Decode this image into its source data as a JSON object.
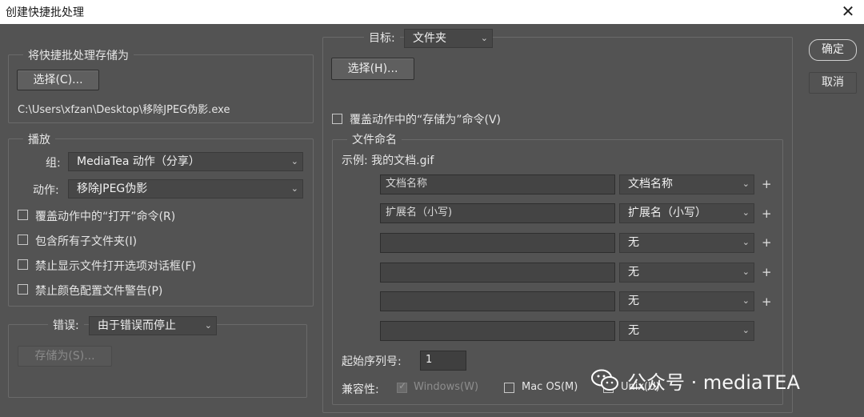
{
  "window": {
    "title": "创建快捷批处理",
    "close_glyph": "✕"
  },
  "save_section": {
    "legend": "将快捷批处理存储为",
    "choose_button": "选择(C)...",
    "path": "C:\\Users\\xfzan\\Desktop\\移除JPEG伪影.exe"
  },
  "play_section": {
    "legend": "播放",
    "group_label": "组:",
    "group_value": "MediaTea 动作（分享）",
    "action_label": "动作:",
    "action_value": "移除JPEG伪影",
    "checkboxes": [
      {
        "label": "覆盖动作中的“打开”命令(R)",
        "checked": false
      },
      {
        "label": "包含所有子文件夹(I)",
        "checked": false
      },
      {
        "label": "禁止显示文件打开选项对话框(F)",
        "checked": false
      },
      {
        "label": "禁止颜色配置文件警告(P)",
        "checked": false
      }
    ]
  },
  "error_section": {
    "label": "错误:",
    "value": "由于错误而停止",
    "save_as_button": "存储为(S)..."
  },
  "target_section": {
    "label": "目标:",
    "value": "文件夹",
    "choose_button": "选择(H)...",
    "override_save_as": {
      "label": "覆盖动作中的“存储为”命令(V)",
      "checked": false
    }
  },
  "naming": {
    "legend": "文件命名",
    "example": "示例: 我的文档.gif",
    "rows": [
      {
        "field": "文档名称",
        "select": "文档名称",
        "plus": "+"
      },
      {
        "field": "扩展名（小写)",
        "select": "扩展名（小写）",
        "plus": "+"
      },
      {
        "field": "",
        "select": "无",
        "plus": "+"
      },
      {
        "field": "",
        "select": "无",
        "plus": "+"
      },
      {
        "field": "",
        "select": "无",
        "plus": "+"
      },
      {
        "field": "",
        "select": "无",
        "plus": ""
      }
    ],
    "start_serial_label": "起始序列号:",
    "start_serial_value": "1",
    "compat_label": "兼容性:",
    "compat": [
      {
        "label": "Windows(W)",
        "checked": true,
        "disabled": true
      },
      {
        "label": "Mac OS(M)",
        "checked": false,
        "disabled": false
      },
      {
        "label": "Unix(U)",
        "checked": false,
        "disabled": false
      }
    ]
  },
  "actions": {
    "ok": "确定",
    "cancel": "取消"
  },
  "watermark": {
    "text": "公众号 · mediaTEA"
  },
  "icons": {
    "chevron": "⌄"
  }
}
